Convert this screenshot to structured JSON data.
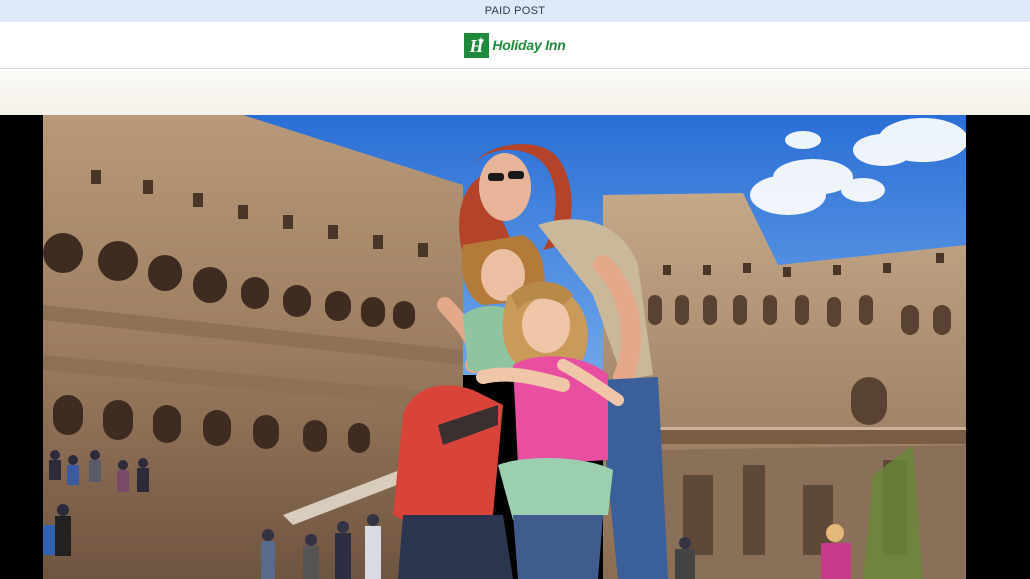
{
  "header": {
    "paid_label": "PAID POST"
  },
  "brand": {
    "logo_letter": "H",
    "logo_text": "Holiday Inn",
    "logo_color": "#1f8a3b"
  },
  "hero": {
    "subject": "woman and two girls in the Colosseum"
  },
  "colors": {
    "top_bar": "#dde8f9",
    "hero_background": "#000000"
  }
}
